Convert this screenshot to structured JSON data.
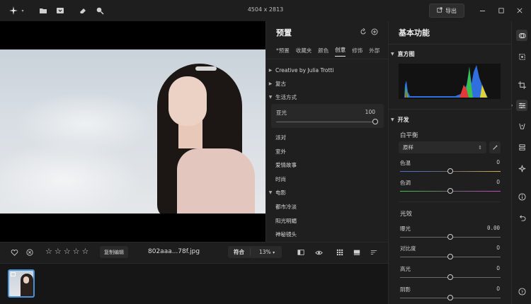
{
  "titlebar": {
    "dimensions": "4504 x 2813",
    "export_label": "导出"
  },
  "preset_panel": {
    "title": "预置",
    "tabs": [
      "*预置",
      "收藏夹",
      "颜色",
      "创意",
      "修饰",
      "外部"
    ],
    "active_tab": 3,
    "rows": [
      {
        "label": "Creative by Julia Trotti",
        "type": "group",
        "expanded": false
      },
      {
        "label": "复古",
        "type": "group",
        "expanded": false
      },
      {
        "label": "生活方式",
        "type": "group",
        "expanded": true
      },
      {
        "label": "亚光",
        "type": "selected",
        "value": "100",
        "slider_fraction": 1.0
      },
      {
        "label": "派对",
        "type": "child"
      },
      {
        "label": "室外",
        "type": "child"
      },
      {
        "label": "爱情故事",
        "type": "child"
      },
      {
        "label": "时尚",
        "type": "child"
      },
      {
        "label": "电影",
        "type": "group",
        "expanded": true
      },
      {
        "label": "都市冷淡",
        "type": "child"
      },
      {
        "label": "阳光明媚",
        "type": "child"
      },
      {
        "label": "神秘镜头",
        "type": "child"
      }
    ]
  },
  "basic_panel": {
    "title": "基本功能",
    "histogram_label": "直方图",
    "develop_label": "开发",
    "white_balance_label": "白平衡",
    "white_balance_value": "原样",
    "temp_label": "色温",
    "temp_value": "0",
    "temp_fraction": 0.5,
    "tint_label": "色调",
    "tint_value": "0",
    "tint_fraction": 0.5,
    "light_label": "光效",
    "exposure_label": "曝光",
    "exposure_value": "0.00",
    "exposure_fraction": 0.5,
    "contrast_label": "对比度",
    "contrast_value": "0",
    "contrast_fraction": 0.5,
    "highlights_label": "高光",
    "highlights_value": "0",
    "highlights_fraction": 0.5,
    "shadows_label": "阴影",
    "shadows_value": "0",
    "shadows_fraction": 0.5
  },
  "bottombar": {
    "copy_edit_label": "复制编辑",
    "filename": "802aaa...78f.jpg",
    "fit_label": "符合",
    "zoom_value": "13%",
    "rating": 0,
    "rating_max": 5
  },
  "colors": {
    "accent": "#4a90d9",
    "hist_blue": "#2f6fe0",
    "hist_green": "#39c24a",
    "hist_red": "#e23a3a",
    "hist_yellow": "#e0d23a"
  }
}
